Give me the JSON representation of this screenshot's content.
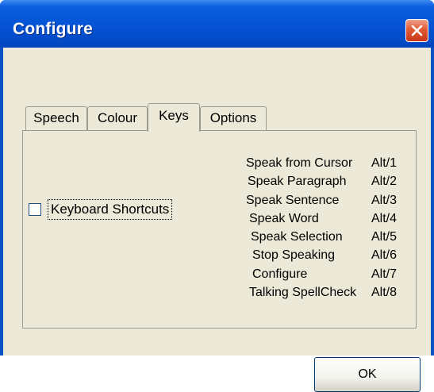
{
  "window": {
    "title": "Configure"
  },
  "tabs": [
    {
      "label": "Speech",
      "selected": false
    },
    {
      "label": "Colour",
      "selected": false
    },
    {
      "label": "Keys",
      "selected": true
    },
    {
      "label": "Options",
      "selected": false
    }
  ],
  "keys_panel": {
    "checkbox_label": "Keyboard Shortcuts",
    "checkbox_checked": false,
    "shortcuts": [
      {
        "name": "Speak from Cursor",
        "key": "Alt/1"
      },
      {
        "name": "Speak Paragraph",
        "key": "Alt/2"
      },
      {
        "name": "Speak Sentence",
        "key": "Alt/3"
      },
      {
        "name": "Speak Word",
        "key": "Alt/4"
      },
      {
        "name": "Speak Selection",
        "key": "Alt/5"
      },
      {
        "name": "Stop Speaking",
        "key": "Alt/6"
      },
      {
        "name": "Configure",
        "key": "Alt/7"
      },
      {
        "name": "Talking SpellCheck",
        "key": "Alt/8"
      }
    ]
  },
  "buttons": {
    "ok_label": "OK"
  },
  "colors": {
    "titlebar": "#0553d6",
    "close_button": "#e15a33",
    "dialog_face": "#ece9d8"
  }
}
